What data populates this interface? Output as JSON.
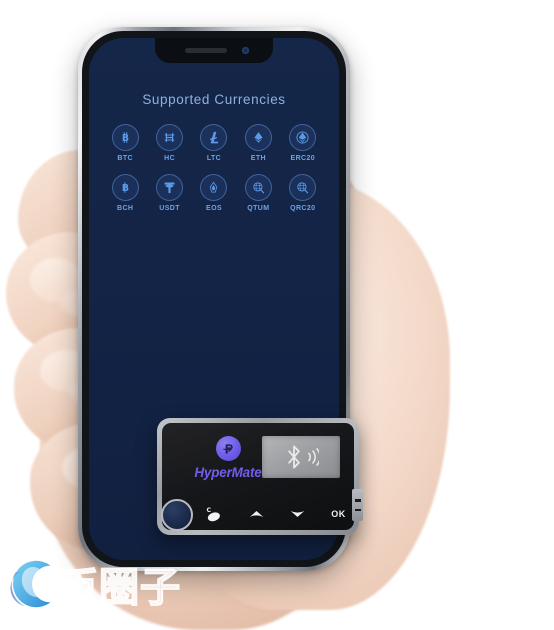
{
  "background_color": "#ffffff",
  "phone": {
    "name": "smartphone-mockup",
    "screen": {
      "title": "Supported Currencies",
      "background_color": "#132447",
      "title_color": "#8fb0e0",
      "currencies": [
        {
          "label": "BTC",
          "icon": "bitcoin-icon"
        },
        {
          "label": "HC",
          "icon": "hypercash-icon"
        },
        {
          "label": "LTC",
          "icon": "litecoin-icon"
        },
        {
          "label": "ETH",
          "icon": "ethereum-icon"
        },
        {
          "label": "ERC20",
          "icon": "erc20-icon"
        },
        {
          "label": "BCH",
          "icon": "bitcoin-cash-icon"
        },
        {
          "label": "USDT",
          "icon": "tether-icon"
        },
        {
          "label": "EOS",
          "icon": "eos-icon"
        },
        {
          "label": "QTUM",
          "icon": "qtum-icon"
        },
        {
          "label": "QRC20",
          "icon": "qrc20-icon"
        }
      ]
    },
    "notch": {
      "speaker": "earpiece-speaker",
      "camera": "front-camera"
    }
  },
  "device": {
    "brand": "HyperMate",
    "brand_color": "#6c5ce7",
    "display": {
      "icon": "bluetooth-icon",
      "state": "bluetooth-pairing",
      "color": "#9ea0a3"
    },
    "buttons": [
      {
        "name": "power-button",
        "label": "C",
        "icon": "power-leaf-icon"
      },
      {
        "name": "up-button",
        "label": "",
        "icon": "chevron-up-icon"
      },
      {
        "name": "down-button",
        "label": "",
        "icon": "chevron-down-icon"
      },
      {
        "name": "ok-button",
        "label": "OK",
        "icon": "ok-text-icon"
      }
    ],
    "knob": "scroll-wheel-knob",
    "port": "connector-port"
  },
  "watermark": {
    "text": "币圈子",
    "logo": "circle-swirl-logo"
  }
}
